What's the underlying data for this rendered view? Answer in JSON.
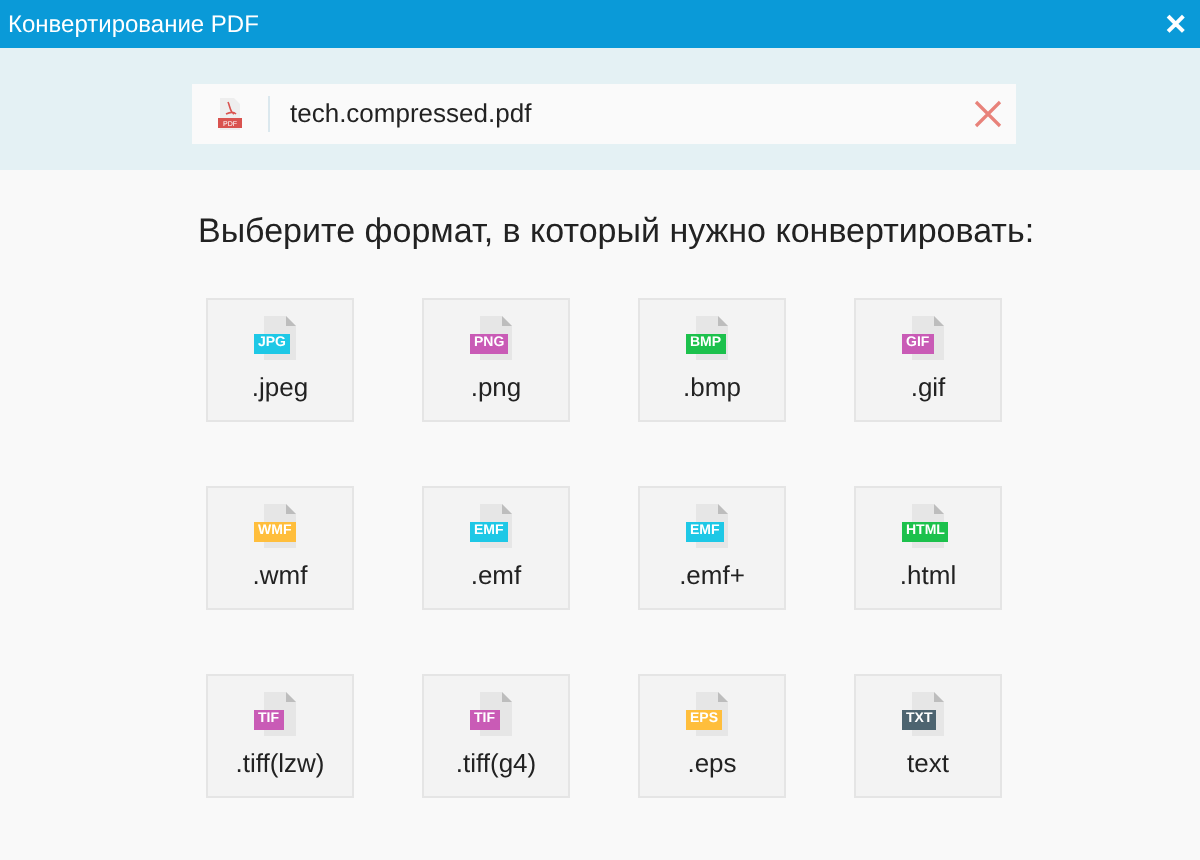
{
  "window": {
    "title": "Конвертирование PDF",
    "close": "✕"
  },
  "file": {
    "name": "tech.compressed.pdf",
    "badge": "PDF"
  },
  "heading": "Выберите формат, в который нужно конвертировать:",
  "formats": [
    {
      "badge": "JPG",
      "label": ".jpeg",
      "color": "#1ec8e6"
    },
    {
      "badge": "PNG",
      "label": ".png",
      "color": "#c95bb6"
    },
    {
      "badge": "BMP",
      "label": ".bmp",
      "color": "#1cc14c"
    },
    {
      "badge": "GIF",
      "label": ".gif",
      "color": "#c95bb6"
    },
    {
      "badge": "WMF",
      "label": ".wmf",
      "color": "#ffbe3c"
    },
    {
      "badge": "EMF",
      "label": ".emf",
      "color": "#1ec8e6"
    },
    {
      "badge": "EMF",
      "label": ".emf+",
      "color": "#1ec8e6"
    },
    {
      "badge": "HTML",
      "label": ".html",
      "color": "#1cc14c"
    },
    {
      "badge": "TIF",
      "label": ".tiff(lzw)",
      "color": "#c95bb6"
    },
    {
      "badge": "TIF",
      "label": ".tiff(g4)",
      "color": "#c95bb6"
    },
    {
      "badge": "EPS",
      "label": ".eps",
      "color": "#ffbe3c"
    },
    {
      "badge": "TXT",
      "label": "text",
      "color": "#4d6470"
    }
  ]
}
